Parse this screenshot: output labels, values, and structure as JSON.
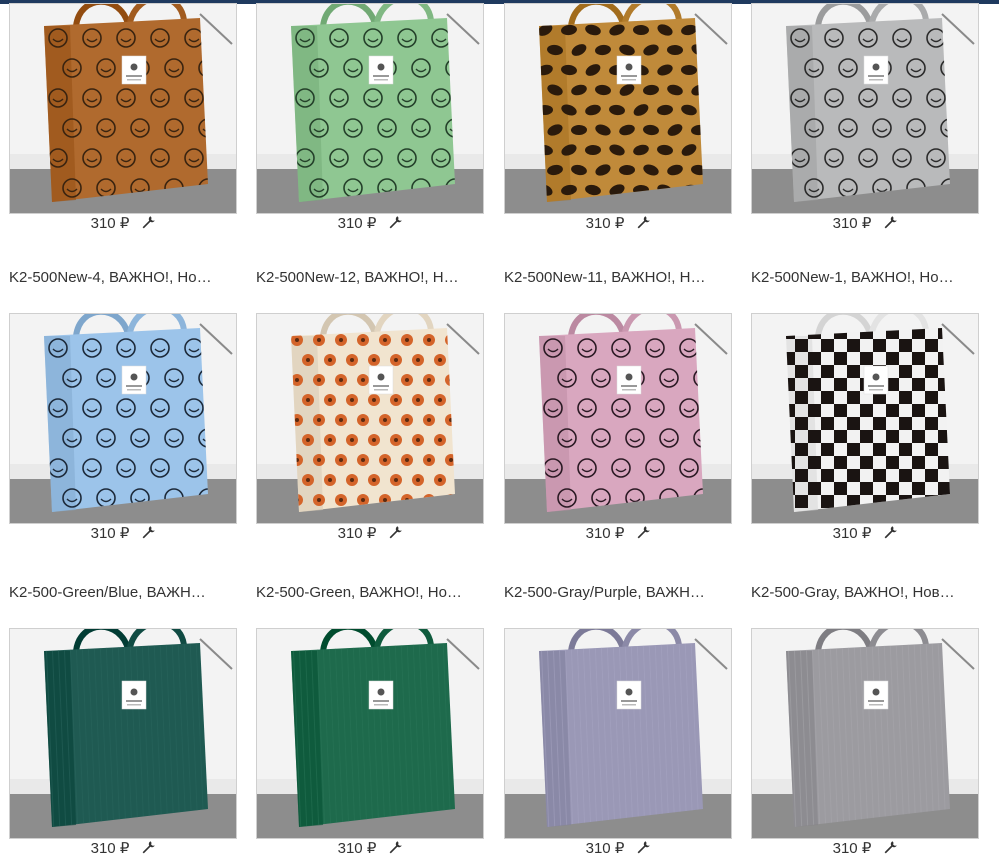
{
  "colors": {
    "topbar": "#1f3a5f",
    "text": "#333333",
    "border": "#cfcfcf"
  },
  "products": [
    {
      "title": "",
      "price": "310 ₽",
      "icon": "wrench-icon",
      "bag_color": "#b06a2e",
      "pattern": "smiley",
      "pattern_color": "#3a2410"
    },
    {
      "title": "",
      "price": "310 ₽",
      "icon": "wrench-icon",
      "bag_color": "#8fc792",
      "pattern": "smiley",
      "pattern_color": "#24402a"
    },
    {
      "title": "",
      "price": "310 ₽",
      "icon": "wrench-icon",
      "bag_color": "#c08a3a",
      "pattern": "leopard",
      "pattern_color": "#2a1a0c"
    },
    {
      "title": "",
      "price": "310 ₽",
      "icon": "wrench-icon",
      "bag_color": "#b9babb",
      "pattern": "smiley",
      "pattern_color": "#2b2b2b"
    },
    {
      "title": "K2-500New-4, ВАЖНО!, Но…",
      "price": "310 ₽",
      "icon": "wrench-icon",
      "bag_color": "#9cc4ea",
      "pattern": "smiley",
      "pattern_color": "#1d2a3a"
    },
    {
      "title": "K2-500New-12, ВАЖНО!, Н…",
      "price": "310 ₽",
      "icon": "wrench-icon",
      "bag_color": "#f1e4cf",
      "pattern": "flower",
      "pattern_color": "#d4642a"
    },
    {
      "title": "K2-500New-11, ВАЖНО!, Н…",
      "price": "310 ₽",
      "icon": "wrench-icon",
      "bag_color": "#d9a7bf",
      "pattern": "smiley",
      "pattern_color": "#2b1a24"
    },
    {
      "title": "K2-500New-1, ВАЖНО!, Но…",
      "price": "310 ₽",
      "icon": "wrench-icon",
      "bag_color": "#f2f2f2",
      "pattern": "checker",
      "pattern_color": "#1a1412"
    },
    {
      "title": "K2-500-Green/Blue, ВАЖН…",
      "price": "310 ₽",
      "icon": "wrench-icon",
      "bag_color": "#1f5a52",
      "pattern": "plain",
      "pattern_color": ""
    },
    {
      "title": "K2-500-Green, ВАЖНО!, Но…",
      "price": "310 ₽",
      "icon": "wrench-icon",
      "bag_color": "#1e6a4c",
      "pattern": "plain",
      "pattern_color": ""
    },
    {
      "title": "K2-500-Gray/Purple, ВАЖН…",
      "price": "310 ₽",
      "icon": "wrench-icon",
      "bag_color": "#9a98b6",
      "pattern": "plain",
      "pattern_color": ""
    },
    {
      "title": "K2-500-Gray, ВАЖНО!, Нов…",
      "price": "310 ₽",
      "icon": "wrench-icon",
      "bag_color": "#9c9ba0",
      "pattern": "plain",
      "pattern_color": ""
    }
  ]
}
